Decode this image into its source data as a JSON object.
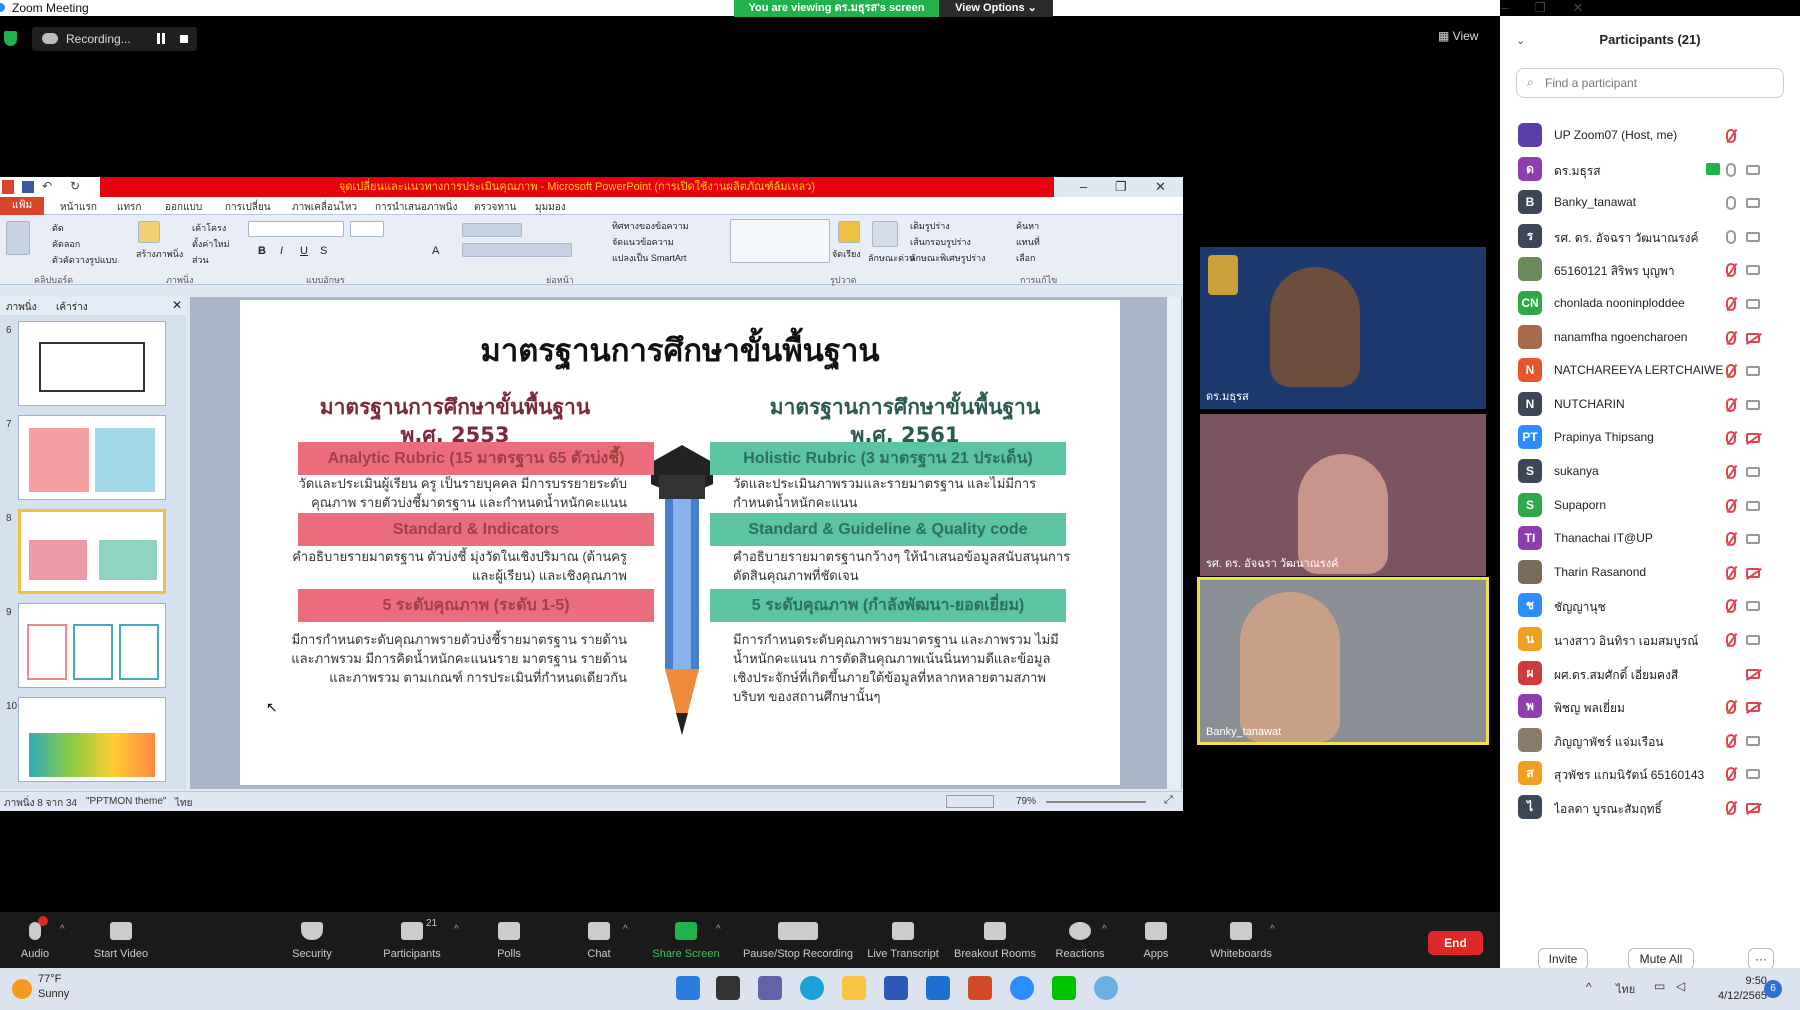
{
  "window": {
    "title": "Zoom Meeting"
  },
  "banner": {
    "viewing": "You are viewing ดร.มธุรส's screen",
    "view_options": "View Options ⌄"
  },
  "recording": {
    "label": "Recording..."
  },
  "view_btn": "View",
  "ppt": {
    "title": "จุดเปลี่ยนและแนวทางการประเมินคุณภาพ - Microsoft PowerPoint (การเปิดใช้งานผลิตภัณฑ์ล้มเหลว)",
    "file_tab": "แฟ้ม",
    "tabs": [
      "หน้าแรก",
      "แทรก",
      "ออกแบบ",
      "การเปลี่ยน",
      "ภาพเคลื่อนไหว",
      "การนำเสนอภาพนิ่ง",
      "ตรวจทาน",
      "มุมมอง"
    ],
    "groups": [
      "คลิปบอร์ด",
      "ภาพนิ่ง",
      "แบบอักษร",
      "ย่อหน้า",
      "รูปวาด",
      "การแก้ไข"
    ],
    "ribbon_labels": [
      "ตัด",
      "คัดลอก",
      "ตัวคัดวางรูปแบบ",
      "เค้าโครง",
      "ตั้งค่าใหม่",
      "ส่วน",
      "ทิศทางของข้อความ",
      "จัดแนวข้อความ",
      "แปลงเป็น SmartArt",
      "ค้นหา",
      "แทนที่",
      "เลือก",
      "จัดเรียง",
      "ลักษณะด่วน",
      "เติมรูปร่าง",
      "เส้นกรอบรูปร่าง",
      "ลักษณะพิเศษรูปร่าง",
      "สร้างภาพนิ่ง"
    ],
    "pane_tabs": [
      "ภาพนิ่ง",
      "เค้าร่าง"
    ],
    "thumb_nums": [
      "6",
      "7",
      "8",
      "9",
      "10"
    ],
    "status_slide": "ภาพนิ่ง 8 จาก 34",
    "status_theme": "\"PPTMON theme\"",
    "status_lang": "ไทย",
    "zoom": "79%"
  },
  "slide": {
    "title": "มาตรฐานการศึกษาขั้นพื้นฐาน",
    "left_head": [
      "มาตรฐานการศึกษาขั้นพื้นฐาน",
      "พ.ศ. 2553"
    ],
    "right_head": [
      "มาตรฐานการศึกษาขั้นพื้นฐาน",
      "พ.ศ. 2561"
    ],
    "bar_l1": "Analytic Rubric (15 มาตรฐาน 65 ตัวบ่งชี้)",
    "bar_r1": "Holistic Rubric (3 มาตรฐาน 21 ประเด็น)",
    "desc_l1": "วัดและประเมินผู้เรียน ครู เป็นรายบุคคล มีการบรรยายระดับคุณภาพ รายตัวบ่งชี้มาตรฐาน และกำหนดน้ำหนักคะแนน",
    "desc_r1": "วัดและประเมินภาพรวมและรายมาตรฐาน และไม่มีการกำหนดน้ำหนักคะแนน",
    "bar_l2": "Standard & Indicators",
    "bar_r2": "Standard & Guideline & Quality code",
    "desc_l2": "คำอธิบายรายมาตรฐาน ตัวบ่งชี้ มุ่งวัดในเชิงปริมาณ (ด้านครูและผู้เรียน) และเชิงคุณภาพ",
    "desc_r2": "คำอธิบายรายมาตรฐานกว้างๆ ให้นำเสนอข้อมูลสนับสนุนการตัดสินคุณภาพที่ชัดเจน",
    "bar_l3": "5 ระดับคุณภาพ (ระดับ 1-5)",
    "bar_r3": "5 ระดับคุณภาพ (กำลังพัฒนา-ยอดเยี่ยม)",
    "desc_l3": "มีการกำหนดระดับคุณภาพรายตัวบ่งชี้รายมาตรฐาน รายด้าน และภาพรวม มีการคิดน้ำหนักคะแนนราย มาตรฐาน รายด้าน และภาพรวม ตามเกณฑ์ การประเมินที่กำหนดเดียวกัน",
    "desc_r3": "มีการกำหนดระดับคุณภาพรายมาตรฐาน และภาพรวม ไม่มีน้ำหนักคะแนน การตัดสินคุณภาพเน้นนิ่นทามดีและข้อมูล เชิงประจักษ์ที่เกิดขึ้นภายใต้ข้อมูลที่หลากหลายตามสภาพบริบท ของสถานศึกษานั้นๆ"
  },
  "videos": [
    {
      "name": "ดร.มธุรส",
      "bg": "#1d3a6e"
    },
    {
      "name": "รศ. ดร. อัจฉรา วัฒนาณรงค์",
      "bg": "#7a5560"
    },
    {
      "name": "Banky_tanawat",
      "bg": "#8a8f96"
    }
  ],
  "participants": {
    "title": "Participants (21)",
    "search_placeholder": "Find a participant",
    "list": [
      {
        "name": "UP Zoom07 (Host, me)",
        "initial": "",
        "color": "#5a3fa8",
        "mic": "off",
        "cam": "none"
      },
      {
        "name": "ดร.มธุรส",
        "initial": "ด",
        "color": "#8d3fb2",
        "mic": "on",
        "cam": "on",
        "share": true
      },
      {
        "name": "Banky_tanawat",
        "initial": "B",
        "color": "#3b4656",
        "mic": "on",
        "cam": "on"
      },
      {
        "name": "รศ. ดร. อัจฉรา วัฒนาณรงค์",
        "initial": "ร",
        "color": "#3b4656",
        "mic": "on",
        "cam": "on"
      },
      {
        "name": "65160121 สิริพร บุญพา",
        "initial": "",
        "color": "#6b8a5a",
        "mic": "off",
        "cam": "on"
      },
      {
        "name": "chonlada nooninploddee",
        "initial": "CN",
        "color": "#2fa84a",
        "mic": "off",
        "cam": "on"
      },
      {
        "name": "nanamfha ngoencharoen",
        "initial": "",
        "color": "#a86a4a",
        "mic": "off",
        "cam": "off"
      },
      {
        "name": "NATCHAREEYA LERTCHAIWEERA...",
        "initial": "N",
        "color": "#e8552a",
        "mic": "off",
        "cam": "on"
      },
      {
        "name": "NUTCHARIN",
        "initial": "N",
        "color": "#3b4656",
        "mic": "off",
        "cam": "on"
      },
      {
        "name": "Prapinya  Thipsang",
        "initial": "PT",
        "color": "#2d8cff",
        "mic": "off",
        "cam": "off"
      },
      {
        "name": "sukanya",
        "initial": "S",
        "color": "#3b4656",
        "mic": "off",
        "cam": "on"
      },
      {
        "name": "Supaporn",
        "initial": "S",
        "color": "#2fa84a",
        "mic": "off",
        "cam": "on"
      },
      {
        "name": "Thanachai IT@UP",
        "initial": "TI",
        "color": "#8d3fb2",
        "mic": "off",
        "cam": "on"
      },
      {
        "name": "Tharin Rasanond",
        "initial": "",
        "color": "#7a6a5a",
        "mic": "off",
        "cam": "off"
      },
      {
        "name": "ชัญญานุช",
        "initial": "ช",
        "color": "#2d8cff",
        "mic": "off",
        "cam": "on"
      },
      {
        "name": "นางสาว อินทิรา เอมสมบูรณ์",
        "initial": "น",
        "color": "#f0a020",
        "mic": "off",
        "cam": "on"
      },
      {
        "name": "ผศ.ดร.สมศักดิ์ เอี่ยมคงสี",
        "initial": "ผ",
        "color": "#d03a3a",
        "mic": "none",
        "cam": "off"
      },
      {
        "name": "พิชญ พลเยี่ยม",
        "initial": "พ",
        "color": "#8d3fb2",
        "mic": "off",
        "cam": "off"
      },
      {
        "name": "ภิญญาพัชร์ แจ่มเรือน",
        "initial": "",
        "color": "#8a7a6a",
        "mic": "off",
        "cam": "on"
      },
      {
        "name": "สุวพัชร แกมนิรัตน์ 65160143",
        "initial": "ส",
        "color": "#f0a020",
        "mic": "off",
        "cam": "on"
      },
      {
        "name": "ไอลดา บูรณะสัมฤทธิ์",
        "initial": "ไ",
        "color": "#3b4656",
        "mic": "off",
        "cam": "off"
      }
    ],
    "invite": "Invite",
    "mute_all": "Mute All",
    "more": "···"
  },
  "toolbar": {
    "items": [
      "Audio",
      "Start Video",
      "Security",
      "Participants",
      "Polls",
      "Chat",
      "Share Screen",
      "Pause/Stop Recording",
      "Live Transcript",
      "Breakout Rooms",
      "Reactions",
      "Apps",
      "Whiteboards"
    ],
    "participants_count": "21",
    "end": "End"
  },
  "taskbar": {
    "temp": "77°F",
    "weather": "Sunny",
    "lang": "ไทย",
    "time": "9:50",
    "date": "4/12/2565",
    "notif": "6"
  }
}
